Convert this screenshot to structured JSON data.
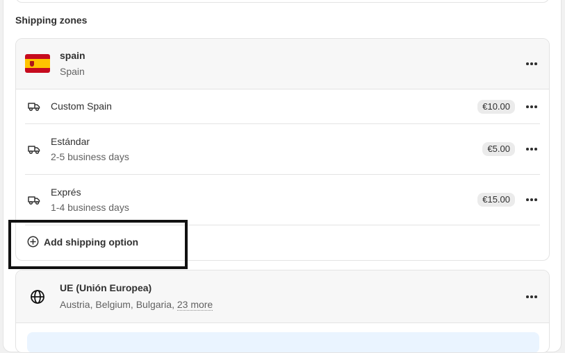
{
  "section": {
    "title": "Shipping zones"
  },
  "zones": [
    {
      "name": "spain",
      "countries": "Spain",
      "options": [
        {
          "name": "Custom Spain",
          "description": "",
          "price": "€10.00"
        },
        {
          "name": "Estándar",
          "description": "2-5 business days",
          "price": "€5.00"
        },
        {
          "name": "Exprés",
          "description": "1-4 business days",
          "price": "€15.00"
        }
      ],
      "add_option_label": "Add shipping option"
    },
    {
      "name": "UE (Unión Europea)",
      "countries": "Austria, Belgium, Bulgaria,",
      "more_link": "23 more"
    }
  ],
  "icons": {
    "flag": "spain-flag-icon",
    "globe": "globe-icon",
    "truck": "truck-icon",
    "add": "plus-circle-icon",
    "menu": "more-horizontal-icon"
  },
  "colors": {
    "text": "#303030",
    "subtext": "#616161",
    "border": "#e3e3e3",
    "header_bg": "#f7f7f7",
    "price_badge_bg": "#ebebeb",
    "highlight": "#111111"
  }
}
